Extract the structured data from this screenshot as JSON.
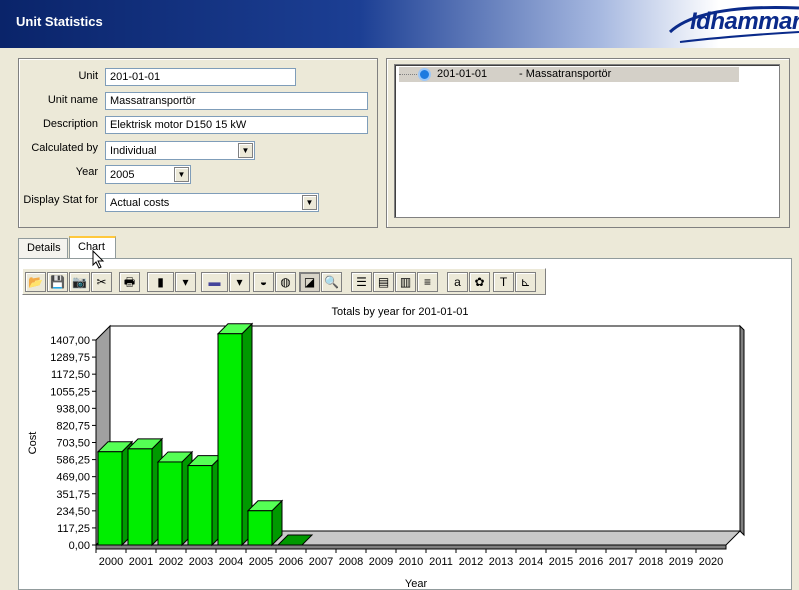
{
  "window": {
    "title": "Unit Statistics",
    "logo_text": "Idhammar"
  },
  "form": {
    "unit_label": "Unit",
    "unit_value": "201-01-01",
    "unit_name_label": "Unit name",
    "unit_name_value": "Massatransportör",
    "description_label": "Description",
    "description_value": "Elektrisk motor D150 15 kW",
    "calculated_by_label": "Calculated by",
    "calculated_by_value": "Individual",
    "year_label": "Year",
    "year_value": "2005",
    "display_stat_label": "Display Stat for",
    "display_stat_value": "Actual costs"
  },
  "tree": {
    "items": [
      {
        "id": "201-01-01",
        "name": "- Massatransportör"
      }
    ]
  },
  "tabs": [
    {
      "label": "Details"
    },
    {
      "label": "Chart"
    }
  ],
  "toolbar": {
    "buttons": [
      "open-icon",
      "save-icon",
      "camera-icon",
      "cut-icon",
      "print-icon",
      "bar-chart-icon",
      "dropdown-arrow-icon",
      "color-icon",
      "dropdown-arrow-icon",
      "3d-view-icon",
      "rotate-icon",
      "light-icon",
      "zoom-icon",
      "data-sheet-icon",
      "properties-icon",
      "vertical-grid-icon",
      "horizontal-grid-icon",
      "label-icon",
      "palette-icon",
      "tools-icon",
      "axis-icon"
    ]
  },
  "colors": {
    "bar": "#00ee00",
    "bar_dark": "#009900",
    "bar_top": "#55ff55",
    "wall": "#ffffff",
    "side": "#a0a0a0",
    "floor": "#c8c8c8"
  },
  "chart_data": {
    "type": "bar",
    "title": "Totals by year for 201-01-01",
    "xlabel": "Year",
    "ylabel": "Cost",
    "categories": [
      "2000",
      "2001",
      "2002",
      "2003",
      "2004",
      "2005",
      "2006",
      "2007",
      "2008",
      "2009",
      "2010",
      "2011",
      "2012",
      "2013",
      "2014",
      "2015",
      "2016",
      "2017",
      "2018",
      "2019",
      "2020"
    ],
    "values": [
      640,
      660,
      570,
      545,
      1450,
      235,
      0,
      0,
      0,
      0,
      0,
      0,
      0,
      0,
      0,
      0,
      0,
      0,
      0,
      0,
      0
    ],
    "yticks": [
      "0,00",
      "117,25",
      "234,50",
      "351,75",
      "469,00",
      "586,25",
      "703,50",
      "820,75",
      "938,00",
      "1055,25",
      "1172,50",
      "1289,75",
      "1407,00"
    ],
    "ylim": [
      0,
      1407
    ],
    "grid": false
  }
}
